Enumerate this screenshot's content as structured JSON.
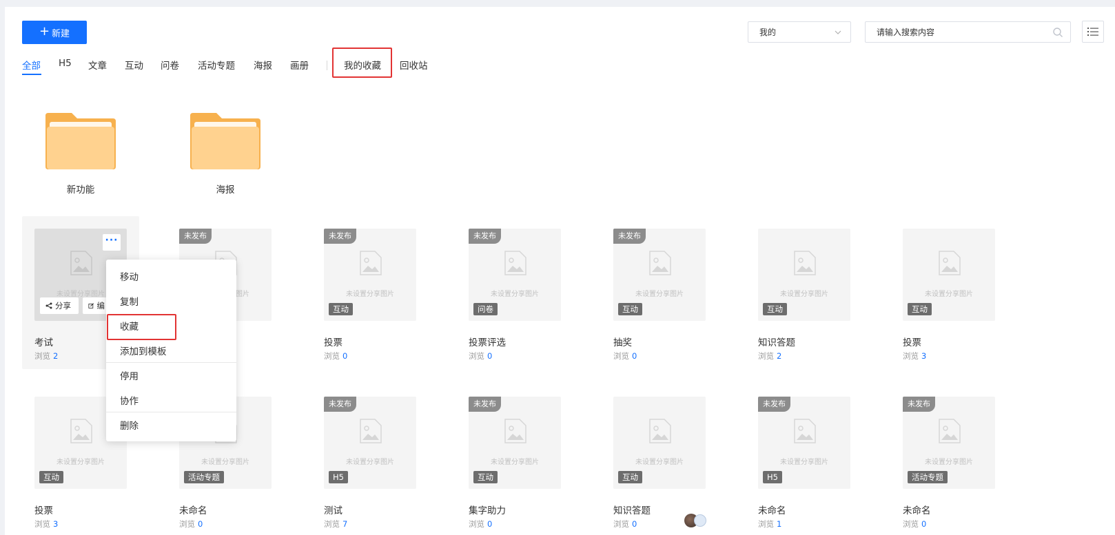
{
  "toolbar": {
    "new_label": "新建",
    "filter_value": "我的",
    "search_placeholder": "请输入搜索内容"
  },
  "tabs": [
    {
      "label": "全部",
      "active": true
    },
    {
      "label": "H5"
    },
    {
      "label": "文章"
    },
    {
      "label": "互动"
    },
    {
      "label": "问卷"
    },
    {
      "label": "活动专题"
    },
    {
      "label": "海报"
    },
    {
      "label": "画册"
    },
    {
      "label": "我的收藏",
      "highlighted": true
    },
    {
      "label": "回收站"
    }
  ],
  "folders": [
    {
      "name": "新功能"
    },
    {
      "name": "海报"
    }
  ],
  "no_image_text": "未设置分享图片",
  "unpublished_label": "未发布",
  "views_label": "浏览",
  "card_actions": {
    "share": "分享",
    "edit": "编"
  },
  "cards_row1": [
    {
      "title": "考试",
      "views": "2",
      "type": "",
      "unpublished": false
    },
    {
      "title": "",
      "views": "",
      "type": "",
      "unpublished": true
    },
    {
      "title": "投票",
      "views": "0",
      "type": "互动",
      "unpublished": true
    },
    {
      "title": "投票评选",
      "views": "0",
      "type": "问卷",
      "unpublished": true
    },
    {
      "title": "抽奖",
      "views": "0",
      "type": "互动",
      "unpublished": true
    },
    {
      "title": "知识答题",
      "views": "2",
      "type": "互动",
      "unpublished": false
    },
    {
      "title": "投票",
      "views": "3",
      "type": "互动",
      "unpublished": false
    }
  ],
  "cards_row2": [
    {
      "title": "投票",
      "views": "3",
      "type": "互动",
      "unpublished": false
    },
    {
      "title": "未命名",
      "views": "0",
      "type": "活动专题",
      "unpublished": false
    },
    {
      "title": "测试",
      "views": "7",
      "type": "H5",
      "unpublished": true
    },
    {
      "title": "集字助力",
      "views": "0",
      "type": "互动",
      "unpublished": true
    },
    {
      "title": "知识答题",
      "views": "0",
      "type": "互动",
      "unpublished": false
    },
    {
      "title": "未命名",
      "views": "1",
      "type": "H5",
      "unpublished": true
    },
    {
      "title": "未命名",
      "views": "0",
      "type": "活动专题",
      "unpublished": true
    }
  ],
  "context_menu": [
    {
      "label": "移动"
    },
    {
      "label": "复制"
    },
    {
      "label": "收藏",
      "highlighted": true
    },
    {
      "label": "添加到模板"
    },
    {
      "label": "停用"
    },
    {
      "label": "协作"
    },
    {
      "label": "删除"
    }
  ],
  "colors": {
    "accent": "#1470ff",
    "highlight_border": "#e23333",
    "folder": "#ffd28f"
  }
}
